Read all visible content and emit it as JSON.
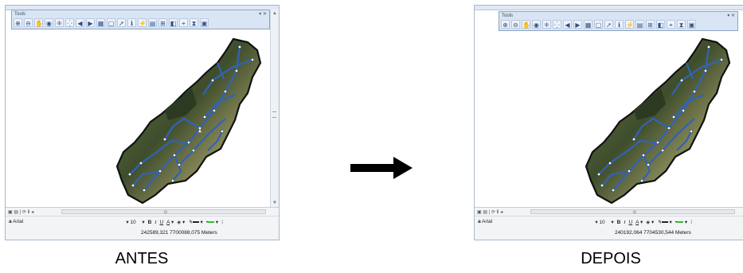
{
  "left_panel": {
    "caption": "ANTES",
    "toolbar_title": "Tools",
    "font_name": "Arial",
    "font_size": "10",
    "coords": "242589,321  7700088,075 Meters"
  },
  "right_panel": {
    "caption": "DEPOIS",
    "toolbar_title": "Tools",
    "font_name": "Arial",
    "font_size": "10",
    "coords": "240192,064  7704530,544 Meters"
  },
  "toolbar_icons": [
    "zoom-in-icon",
    "zoom-out-icon",
    "pan-icon",
    "full-extent-icon",
    "fixed-zoom-in-icon",
    "fixed-zoom-out-icon",
    "back-icon",
    "forward-icon",
    "select-features-icon",
    "clear-selection-icon",
    "pointer-icon",
    "identify-icon",
    "hyperlink-icon",
    "html-popup-icon",
    "measure-icon",
    "find-icon",
    "go-to-xy-icon",
    "time-slider-icon",
    "create-viewer-icon"
  ],
  "format": {
    "bold": "B",
    "italic": "I",
    "underline": "U",
    "font_color_label": "A"
  },
  "colors": {
    "map_green": "#5b6b3a",
    "road_blue": "#2f63b8",
    "window_border": "#a9b8cc",
    "toolbar_bg": "#d9e5f4"
  }
}
